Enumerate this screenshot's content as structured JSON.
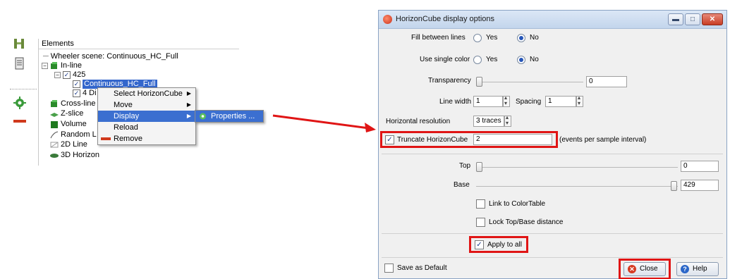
{
  "tree": {
    "header": "Elements",
    "items": [
      {
        "label": "Wheeler scene: Continuous_HC_Full"
      },
      {
        "label": "In-line"
      },
      {
        "label": "425"
      },
      {
        "label": "Continuous_HC_Full"
      },
      {
        "label": "4 Di"
      },
      {
        "label": "Cross-line"
      },
      {
        "label": "Z-slice"
      },
      {
        "label": "Volume"
      },
      {
        "label": "Random L"
      },
      {
        "label": "2D Line"
      },
      {
        "label": "3D Horizon"
      }
    ],
    "expander_minus": "⊟"
  },
  "context_menu": {
    "items": [
      "Select HorizonCube",
      "Move",
      "Display",
      "Reload",
      "Remove"
    ],
    "submenu_item": "Properties ..."
  },
  "dialog": {
    "title": "HorizonCube display options",
    "fill_between_lines": {
      "label": "Fill between lines",
      "yes": "Yes",
      "no": "No",
      "selected": "No"
    },
    "use_single_color": {
      "label": "Use single color",
      "yes": "Yes",
      "no": "No",
      "selected": "No"
    },
    "transparency": {
      "label": "Transparency",
      "value": "0"
    },
    "line_width": {
      "label": "Line width",
      "value": "1"
    },
    "spacing": {
      "label": "Spacing",
      "value": "1"
    },
    "horizontal_resolution": {
      "label": "Horizontal resolution",
      "value": "3 traces"
    },
    "truncate": {
      "label": "Truncate HorizonCube",
      "value": "2",
      "unit": "(events per sample interval)",
      "checked": true
    },
    "top": {
      "label": "Top",
      "value": "0"
    },
    "base": {
      "label": "Base",
      "value": "429"
    },
    "link_colortable": {
      "label": "Link to ColorTable",
      "checked": false
    },
    "lock_distance": {
      "label": "Lock Top/Base distance",
      "checked": false
    },
    "apply_to_all": {
      "label": "Apply to all",
      "checked": true
    },
    "save_default": {
      "label": "Save as Default",
      "checked": false
    },
    "close_label": "Close",
    "help_label": "Help"
  },
  "colors": {
    "accent": "#3366cc",
    "highlight": "#e01515"
  }
}
